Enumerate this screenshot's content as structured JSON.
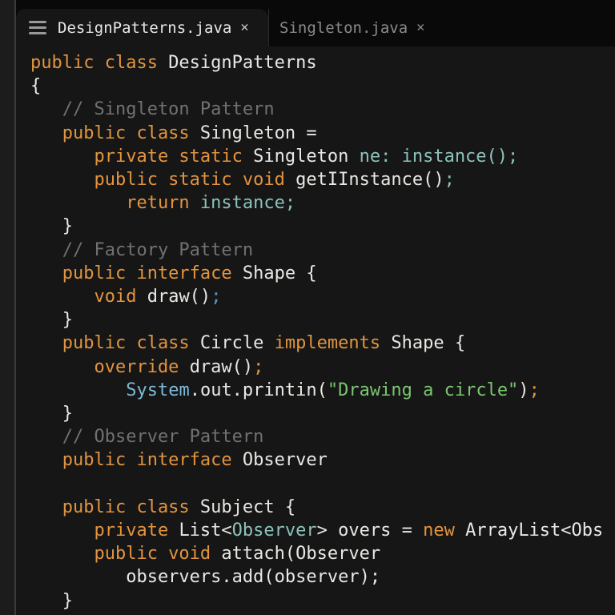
{
  "colors": {
    "editor_bg": "#161616",
    "tabbar_bg": "#090909",
    "strip_bg": "#1c1c1c",
    "panel_border": "#3a3a3a",
    "separator": "#2b2b2b",
    "kw": "#e2943f",
    "id": "#eae8e4",
    "cm": "#717171",
    "tl": "#8cc2ba",
    "st": "#7cc572",
    "bl": "#539bd6",
    "sy": "#7fb9d8",
    "tab_active_text": "#e8e8e8",
    "tab_inactive_text": "#8a8a8a"
  },
  "tabbar": {
    "tabs": [
      {
        "label": "DesignPatterns.java",
        "close": "✕",
        "active": true
      },
      {
        "label": "Singleton.java",
        "close": "✕",
        "active": false
      }
    ]
  },
  "editor": {
    "language": "java",
    "lines": [
      {
        "tokens": [
          {
            "t": "public class ",
            "c": "kw"
          },
          {
            "t": "DesignPatterns",
            "c": "id"
          }
        ]
      },
      {
        "tokens": [
          {
            "t": "{",
            "c": "id"
          }
        ]
      },
      {
        "tokens": [
          {
            "t": "   // Singleton Pattern",
            "c": "cm"
          }
        ]
      },
      {
        "tokens": [
          {
            "t": "   public class ",
            "c": "kw"
          },
          {
            "t": "Singleton =",
            "c": "id"
          }
        ]
      },
      {
        "tokens": [
          {
            "t": "      private static ",
            "c": "kw"
          },
          {
            "t": "Singleton ",
            "c": "id"
          },
          {
            "t": "ne: instance();",
            "c": "tl"
          }
        ]
      },
      {
        "tokens": [
          {
            "t": "      public static void ",
            "c": "kw"
          },
          {
            "t": "getIInstance()",
            "c": "id"
          },
          {
            "t": ";",
            "c": "tl"
          }
        ]
      },
      {
        "tokens": [
          {
            "t": "         return ",
            "c": "kw"
          },
          {
            "t": "instance;",
            "c": "tl"
          }
        ]
      },
      {
        "tokens": [
          {
            "t": "   }",
            "c": "id"
          }
        ]
      },
      {
        "tokens": [
          {
            "t": "   // Factory Pattern",
            "c": "cm"
          }
        ]
      },
      {
        "tokens": [
          {
            "t": "   public interface ",
            "c": "kw"
          },
          {
            "t": "Shape {",
            "c": "id"
          }
        ]
      },
      {
        "tokens": [
          {
            "t": "      void ",
            "c": "kw"
          },
          {
            "t": "draw()",
            "c": "id"
          },
          {
            "t": ";",
            "c": "bl"
          }
        ]
      },
      {
        "tokens": [
          {
            "t": "   }",
            "c": "id"
          }
        ]
      },
      {
        "tokens": [
          {
            "t": "   public class ",
            "c": "kw"
          },
          {
            "t": "Circle ",
            "c": "id"
          },
          {
            "t": "implements ",
            "c": "kw"
          },
          {
            "t": "Shape {",
            "c": "id"
          }
        ]
      },
      {
        "tokens": [
          {
            "t": "      override ",
            "c": "kw"
          },
          {
            "t": "draw()",
            "c": "id"
          },
          {
            "t": ";",
            "c": "kw"
          }
        ]
      },
      {
        "tokens": [
          {
            "t": "         ",
            "c": "id"
          },
          {
            "t": "System",
            "c": "sy"
          },
          {
            "t": ".out.printin(",
            "c": "id"
          },
          {
            "t": "\"Drawing a circle\"",
            "c": "st"
          },
          {
            "t": ")",
            "c": "id"
          },
          {
            "t": ";",
            "c": "kw"
          }
        ]
      },
      {
        "tokens": [
          {
            "t": "   }",
            "c": "id"
          }
        ]
      },
      {
        "tokens": [
          {
            "t": "   // Observer Pattern",
            "c": "cm"
          }
        ]
      },
      {
        "tokens": [
          {
            "t": "   public interface ",
            "c": "kw"
          },
          {
            "t": "Observer",
            "c": "id"
          }
        ]
      },
      {
        "tokens": []
      },
      {
        "tokens": [
          {
            "t": "   public class ",
            "c": "kw"
          },
          {
            "t": "Subject {",
            "c": "id"
          }
        ]
      },
      {
        "tokens": [
          {
            "t": "      private ",
            "c": "kw"
          },
          {
            "t": "List<",
            "c": "id"
          },
          {
            "t": "Observer",
            "c": "tl"
          },
          {
            "t": "> overs = ",
            "c": "id"
          },
          {
            "t": "new",
            "c": "kw"
          },
          {
            "t": " ArrayList<Obs",
            "c": "id"
          }
        ]
      },
      {
        "tokens": [
          {
            "t": "      public void ",
            "c": "kw"
          },
          {
            "t": "attach(Observer",
            "c": "id"
          }
        ]
      },
      {
        "tokens": [
          {
            "t": "         observers.add(observer);",
            "c": "id"
          }
        ]
      },
      {
        "tokens": [
          {
            "t": "   }",
            "c": "id"
          }
        ]
      }
    ]
  }
}
